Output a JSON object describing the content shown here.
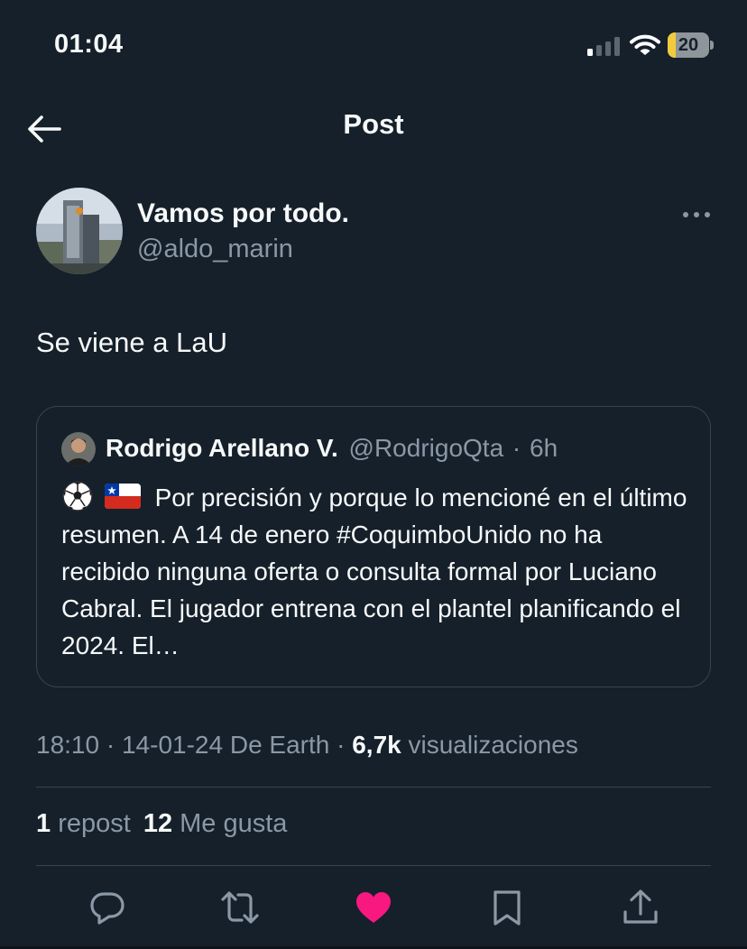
{
  "status_bar": {
    "time": "01:04",
    "battery_level": "20",
    "battery_fraction": 0.2,
    "icons": [
      "signal-icon",
      "wifi-icon",
      "battery-icon"
    ]
  },
  "header": {
    "title": "Post",
    "back_icon": "arrow-left-icon"
  },
  "post": {
    "display_name": "Vamos por todo.",
    "handle": "@aldo_marin",
    "text": "Se viene a LaU",
    "more_icon": "more-horizontal-icon"
  },
  "quoted_post": {
    "display_name": "Rodrigo Arellano V.",
    "handle": "@RodrigoQta",
    "separator": "·",
    "age": "6h",
    "emojis": [
      "soccer-ball-emoji",
      "chile-flag-emoji"
    ],
    "text": "Por precisión y porque lo mencioné en el último resumen. A 14 de enero #CoquimboUnido no ha recibido ninguna oferta o consulta formal por Luciano Cabral. El jugador entrena con el plantel planificando el 2024. El…"
  },
  "meta": {
    "time": "18:10",
    "date": "14-01-24",
    "source": "De Earth",
    "views_count": "6,7k",
    "views_label": "visualizaciones"
  },
  "stats": {
    "reposts_count": "1",
    "reposts_label": "repost",
    "likes_count": "12",
    "likes_label": "Me gusta"
  },
  "actions": [
    "reply-icon",
    "repost-icon",
    "like-icon",
    "bookmark-icon",
    "share-icon"
  ],
  "colors": {
    "background": "#15202b",
    "text": "#f7f9f9",
    "muted": "#8b98a5",
    "border": "#38444d",
    "like": "#f91880",
    "battery": "#f2cb3d"
  }
}
